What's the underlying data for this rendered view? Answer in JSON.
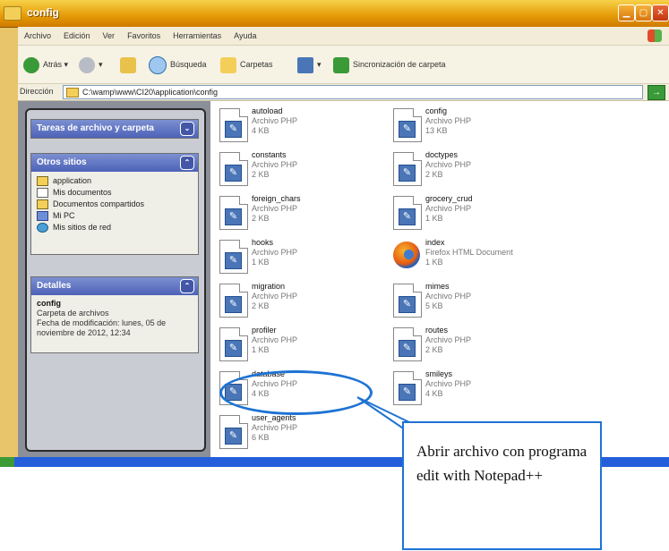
{
  "window": {
    "title": "config"
  },
  "menu": [
    "Archivo",
    "Edición",
    "Ver",
    "Favoritos",
    "Herramientas",
    "Ayuda"
  ],
  "toolbar": {
    "back": "Atrás",
    "search": "Búsqueda",
    "folders": "Carpetas",
    "sync": "Sincronización de carpeta"
  },
  "address": {
    "label": "Dirección",
    "path": "C:\\wamp\\www\\CI20\\application\\config",
    "go": "→"
  },
  "left_panel": {
    "tasks_header": "Tareas de archivo y carpeta",
    "places_header": "Otros sitios",
    "places": [
      {
        "label": "application",
        "icon": "folder-icon"
      },
      {
        "label": "Mis documentos",
        "icon": "documents-icon"
      },
      {
        "label": "Documentos compartidos",
        "icon": "shared-folder-icon"
      },
      {
        "label": "Mi PC",
        "icon": "computer-icon"
      },
      {
        "label": "Mis sitios de red",
        "icon": "network-icon"
      }
    ],
    "details_header": "Detalles",
    "details_name": "config",
    "details_type": "Carpeta de archivos",
    "details_modified": "Fecha de modificación: lunes, 05 de noviembre de 2012, 12:34"
  },
  "files": [
    {
      "name": "autoload",
      "type": "Archivo PHP",
      "size": "4 KB"
    },
    {
      "name": "config",
      "type": "Archivo PHP",
      "size": "13 KB"
    },
    {
      "name": "constants",
      "type": "Archivo PHP",
      "size": "2 KB"
    },
    {
      "name": "doctypes",
      "type": "Archivo PHP",
      "size": "2 KB"
    },
    {
      "name": "foreign_chars",
      "type": "Archivo PHP",
      "size": "2 KB"
    },
    {
      "name": "grocery_crud",
      "type": "Archivo PHP",
      "size": "1 KB"
    },
    {
      "name": "hooks",
      "type": "Archivo PHP",
      "size": "1 KB"
    },
    {
      "name": "index",
      "type": "Firefox HTML Document",
      "size": "1 KB"
    },
    {
      "name": "migration",
      "type": "Archivo PHP",
      "size": "2 KB"
    },
    {
      "name": "mimes",
      "type": "Archivo PHP",
      "size": "5 KB"
    },
    {
      "name": "profiler",
      "type": "Archivo PHP",
      "size": "1 KB"
    },
    {
      "name": "routes",
      "type": "Archivo PHP",
      "size": "2 KB"
    },
    {
      "name": "database",
      "type": "Archivo PHP",
      "size": "4 KB"
    },
    {
      "name": "smileys",
      "type": "Archivo PHP",
      "size": "4 KB"
    },
    {
      "name": "user_agents",
      "type": "Archivo PHP",
      "size": "6 KB"
    }
  ],
  "callout": {
    "text": "Abrir archivo con programa edit with Notepad++"
  },
  "colors": {
    "accent": "#1e73d3",
    "title_bar": "#e59a06",
    "panel_header": "#4d62b8"
  }
}
